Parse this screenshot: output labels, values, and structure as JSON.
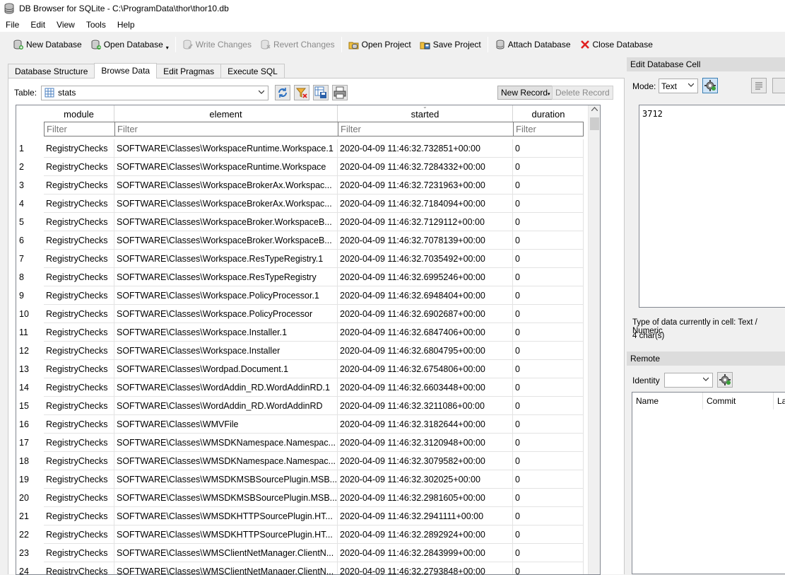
{
  "window": {
    "title": "DB Browser for SQLite - C:\\ProgramData\\thor\\thor10.db"
  },
  "menu": [
    "File",
    "Edit",
    "View",
    "Tools",
    "Help"
  ],
  "toolbar": {
    "new_database": "New Database",
    "open_database": "Open Database",
    "write_changes": "Write Changes",
    "revert_changes": "Revert Changes",
    "open_project": "Open Project",
    "save_project": "Save Project",
    "attach_database": "Attach Database",
    "close_database": "Close Database"
  },
  "tabs": [
    "Database Structure",
    "Browse Data",
    "Edit Pragmas",
    "Execute SQL"
  ],
  "browse": {
    "table_label": "Table:",
    "table_value": "stats",
    "new_record": "New Record",
    "delete_record": "Delete Record",
    "columns": [
      "module",
      "element",
      "started",
      "duration"
    ],
    "filter_placeholder": "Filter",
    "rows": [
      [
        "1",
        "RegistryChecks",
        "SOFTWARE\\Classes\\WorkspaceRuntime.Workspace.1",
        "2020-04-09 11:46:32.732851+00:00",
        "0"
      ],
      [
        "2",
        "RegistryChecks",
        "SOFTWARE\\Classes\\WorkspaceRuntime.Workspace",
        "2020-04-09 11:46:32.7284332+00:00",
        "0"
      ],
      [
        "3",
        "RegistryChecks",
        "SOFTWARE\\Classes\\WorkspaceBrokerAx.Workspac...",
        "2020-04-09 11:46:32.7231963+00:00",
        "0"
      ],
      [
        "4",
        "RegistryChecks",
        "SOFTWARE\\Classes\\WorkspaceBrokerAx.Workspac...",
        "2020-04-09 11:46:32.7184094+00:00",
        "0"
      ],
      [
        "5",
        "RegistryChecks",
        "SOFTWARE\\Classes\\WorkspaceBroker.WorkspaceB...",
        "2020-04-09 11:46:32.7129112+00:00",
        "0"
      ],
      [
        "6",
        "RegistryChecks",
        "SOFTWARE\\Classes\\WorkspaceBroker.WorkspaceB...",
        "2020-04-09 11:46:32.7078139+00:00",
        "0"
      ],
      [
        "7",
        "RegistryChecks",
        "SOFTWARE\\Classes\\Workspace.ResTypeRegistry.1",
        "2020-04-09 11:46:32.7035492+00:00",
        "0"
      ],
      [
        "8",
        "RegistryChecks",
        "SOFTWARE\\Classes\\Workspace.ResTypeRegistry",
        "2020-04-09 11:46:32.6995246+00:00",
        "0"
      ],
      [
        "9",
        "RegistryChecks",
        "SOFTWARE\\Classes\\Workspace.PolicyProcessor.1",
        "2020-04-09 11:46:32.6948404+00:00",
        "0"
      ],
      [
        "10",
        "RegistryChecks",
        "SOFTWARE\\Classes\\Workspace.PolicyProcessor",
        "2020-04-09 11:46:32.6902687+00:00",
        "0"
      ],
      [
        "11",
        "RegistryChecks",
        "SOFTWARE\\Classes\\Workspace.Installer.1",
        "2020-04-09 11:46:32.6847406+00:00",
        "0"
      ],
      [
        "12",
        "RegistryChecks",
        "SOFTWARE\\Classes\\Workspace.Installer",
        "2020-04-09 11:46:32.6804795+00:00",
        "0"
      ],
      [
        "13",
        "RegistryChecks",
        "SOFTWARE\\Classes\\Wordpad.Document.1",
        "2020-04-09 11:46:32.6754806+00:00",
        "0"
      ],
      [
        "14",
        "RegistryChecks",
        "SOFTWARE\\Classes\\WordAddin_RD.WordAddinRD.1",
        "2020-04-09 11:46:32.6603448+00:00",
        "0"
      ],
      [
        "15",
        "RegistryChecks",
        "SOFTWARE\\Classes\\WordAddin_RD.WordAddinRD",
        "2020-04-09 11:46:32.3211086+00:00",
        "0"
      ],
      [
        "16",
        "RegistryChecks",
        "SOFTWARE\\Classes\\WMVFile",
        "2020-04-09 11:46:32.3182644+00:00",
        "0"
      ],
      [
        "17",
        "RegistryChecks",
        "SOFTWARE\\Classes\\WMSDKNamespace.Namespac...",
        "2020-04-09 11:46:32.3120948+00:00",
        "0"
      ],
      [
        "18",
        "RegistryChecks",
        "SOFTWARE\\Classes\\WMSDKNamespace.Namespac...",
        "2020-04-09 11:46:32.3079582+00:00",
        "0"
      ],
      [
        "19",
        "RegistryChecks",
        "SOFTWARE\\Classes\\WMSDKMSBSourcePlugin.MSB...",
        "2020-04-09 11:46:32.302025+00:00",
        "0"
      ],
      [
        "20",
        "RegistryChecks",
        "SOFTWARE\\Classes\\WMSDKMSBSourcePlugin.MSB...",
        "2020-04-09 11:46:32.2981605+00:00",
        "0"
      ],
      [
        "21",
        "RegistryChecks",
        "SOFTWARE\\Classes\\WMSDKHTTPSourcePlugin.HT...",
        "2020-04-09 11:46:32.2941111+00:00",
        "0"
      ],
      [
        "22",
        "RegistryChecks",
        "SOFTWARE\\Classes\\WMSDKHTTPSourcePlugin.HT...",
        "2020-04-09 11:46:32.2892924+00:00",
        "0"
      ],
      [
        "23",
        "RegistryChecks",
        "SOFTWARE\\Classes\\WMSClientNetManager.ClientN...",
        "2020-04-09 11:46:32.2843999+00:00",
        "0"
      ],
      [
        "24",
        "RegistryChecks",
        "SOFTWARE\\Classes\\WMSClientNetManager.ClientN...",
        "2020-04-09 11:46:32.2793848+00:00",
        "0"
      ]
    ]
  },
  "edit_cell": {
    "header": "Edit Database Cell",
    "mode_label": "Mode:",
    "mode_value": "Text",
    "value": "3712",
    "type_info": "Type of data currently in cell: Text / Numeric",
    "size_info": "4 char(s)"
  },
  "remote": {
    "header": "Remote",
    "identity_label": "Identity",
    "columns": [
      "Name",
      "Commit",
      "La"
    ]
  },
  "colors": {
    "accent": "#0078d7",
    "panel_bg": "#f0f0f0",
    "dock_header": "#dcdcdc"
  }
}
